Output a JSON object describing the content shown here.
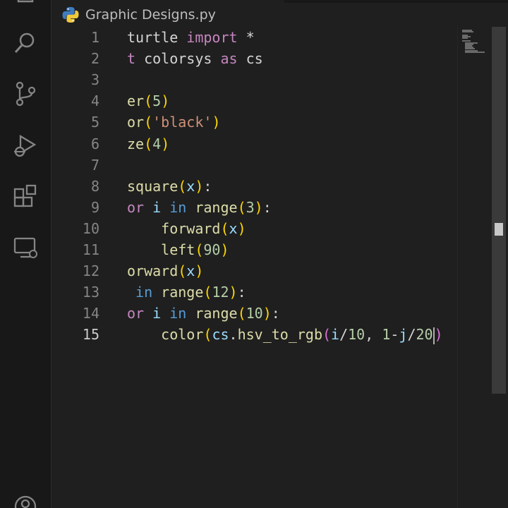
{
  "tab": {
    "filename": "Graphic Designs.py",
    "icon": "python-icon"
  },
  "activity_bar": {
    "items": [
      "search-icon",
      "source-control-icon",
      "run-debug-icon",
      "extensions-icon",
      "remote-explorer-icon",
      "accounts-icon"
    ]
  },
  "editor": {
    "active_line": 15,
    "lines": [
      {
        "n": "1",
        "tokens": [
          [
            "tk-id",
            "turtle "
          ],
          [
            "tk-kw",
            "import"
          ],
          [
            "tk-op",
            " *"
          ]
        ]
      },
      {
        "n": "2",
        "tokens": [
          [
            "tk-kw",
            "t"
          ],
          [
            "tk-id",
            " colorsys "
          ],
          [
            "tk-kw",
            "as"
          ],
          [
            "tk-id",
            " cs"
          ]
        ]
      },
      {
        "n": "3",
        "tokens": []
      },
      {
        "n": "4",
        "tokens": [
          [
            "tk-fn",
            "er"
          ],
          [
            "tk-p1",
            "("
          ],
          [
            "tk-num",
            "5"
          ],
          [
            "tk-p1",
            ")"
          ]
        ]
      },
      {
        "n": "5",
        "tokens": [
          [
            "tk-fn",
            "or"
          ],
          [
            "tk-p1",
            "("
          ],
          [
            "tk-str",
            "'black'"
          ],
          [
            "tk-p1",
            ")"
          ]
        ]
      },
      {
        "n": "6",
        "tokens": [
          [
            "tk-fn",
            "ze"
          ],
          [
            "tk-p1",
            "("
          ],
          [
            "tk-num",
            "4"
          ],
          [
            "tk-p1",
            ")"
          ]
        ]
      },
      {
        "n": "7",
        "tokens": []
      },
      {
        "n": "8",
        "tokens": [
          [
            "tk-fn",
            "square"
          ],
          [
            "tk-p1",
            "("
          ],
          [
            "tk-var",
            "x"
          ],
          [
            "tk-p1",
            ")"
          ],
          [
            "tk-op",
            ":"
          ]
        ]
      },
      {
        "n": "9",
        "tokens": [
          [
            "tk-kw",
            "or"
          ],
          [
            "tk-var",
            " i "
          ],
          [
            "tk-kw2",
            "in"
          ],
          [
            "tk-fn",
            " range"
          ],
          [
            "tk-p1",
            "("
          ],
          [
            "tk-num",
            "3"
          ],
          [
            "tk-p1",
            ")"
          ],
          [
            "tk-op",
            ":"
          ]
        ]
      },
      {
        "n": "10",
        "tokens": [
          [
            "tk-op",
            "    "
          ],
          [
            "tk-fn",
            "forward"
          ],
          [
            "tk-p1",
            "("
          ],
          [
            "tk-var",
            "x"
          ],
          [
            "tk-p1",
            ")"
          ]
        ]
      },
      {
        "n": "11",
        "tokens": [
          [
            "tk-op",
            "    "
          ],
          [
            "tk-fn",
            "left"
          ],
          [
            "tk-p1",
            "("
          ],
          [
            "tk-num",
            "90"
          ],
          [
            "tk-p1",
            ")"
          ]
        ]
      },
      {
        "n": "12",
        "tokens": [
          [
            "tk-fn",
            "orward"
          ],
          [
            "tk-p1",
            "("
          ],
          [
            "tk-var",
            "x"
          ],
          [
            "tk-p1",
            ")"
          ]
        ]
      },
      {
        "n": "13",
        "tokens": [
          [
            "tk-op",
            " "
          ],
          [
            "tk-kw2",
            "in"
          ],
          [
            "tk-fn",
            " range"
          ],
          [
            "tk-p1",
            "("
          ],
          [
            "tk-num",
            "12"
          ],
          [
            "tk-p1",
            ")"
          ],
          [
            "tk-op",
            ":"
          ]
        ]
      },
      {
        "n": "14",
        "tokens": [
          [
            "tk-kw",
            "or"
          ],
          [
            "tk-var",
            " i "
          ],
          [
            "tk-kw2",
            "in"
          ],
          [
            "tk-fn",
            " range"
          ],
          [
            "tk-p1",
            "("
          ],
          [
            "tk-num",
            "10"
          ],
          [
            "tk-p1",
            ")"
          ],
          [
            "tk-op",
            ":"
          ]
        ]
      },
      {
        "n": "15",
        "tokens": [
          [
            "tk-op",
            "    "
          ],
          [
            "tk-fn",
            "color"
          ],
          [
            "tk-p1",
            "("
          ],
          [
            "tk-var",
            "cs"
          ],
          [
            "tk-op",
            "."
          ],
          [
            "tk-fn",
            "hsv_to_rgb"
          ],
          [
            "tk-p2",
            "("
          ],
          [
            "tk-var",
            "i"
          ],
          [
            "tk-op",
            "/"
          ],
          [
            "tk-num",
            "10"
          ],
          [
            "tk-op",
            ", "
          ],
          [
            "tk-num",
            "1"
          ],
          [
            "tk-op",
            "-"
          ],
          [
            "tk-var",
            "j"
          ],
          [
            "tk-op",
            "/"
          ],
          [
            "tk-num",
            "20"
          ],
          [
            "cursor",
            ""
          ],
          [
            "tk-p2",
            ")"
          ]
        ]
      }
    ]
  },
  "colors": {
    "background": "#1f1f1f",
    "activity_bar": "#181818",
    "keyword": "#c586c0",
    "keyword_in": "#569cd6",
    "function": "#dcdcaa",
    "number": "#b5cea8",
    "string": "#ce9178",
    "variable": "#9cdcfe",
    "bracket_1": "#ffd700",
    "bracket_2": "#da70d6"
  }
}
